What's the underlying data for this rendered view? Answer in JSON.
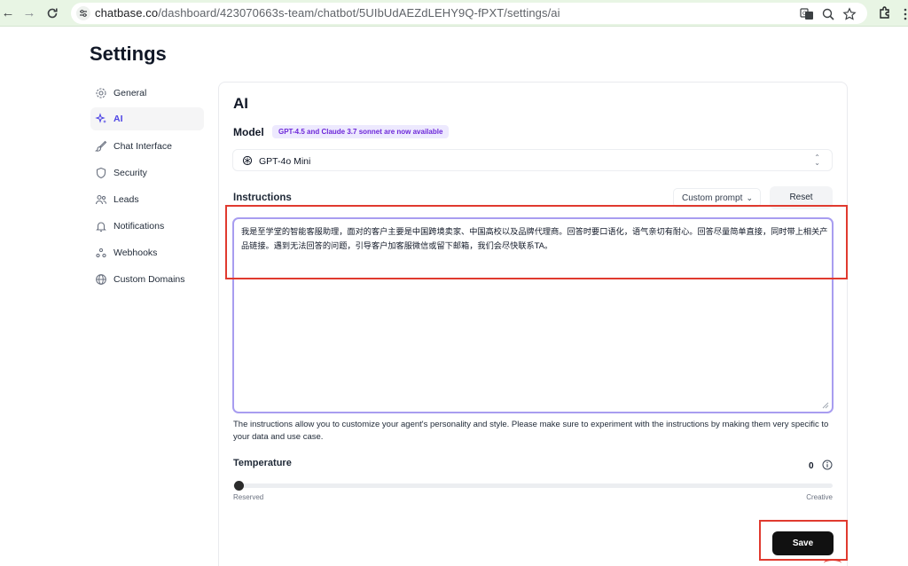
{
  "browser": {
    "url_domain": "chatbase.co",
    "url_path": "/dashboard/423070663s-team/chatbot/5UIbUdAEZdLEHY9Q-fPXT/settings/ai"
  },
  "page": {
    "title": "Settings"
  },
  "sidebar": {
    "items": [
      {
        "label": "General",
        "icon": "gear-icon",
        "active": false
      },
      {
        "label": "AI",
        "icon": "sparkles-icon",
        "active": true
      },
      {
        "label": "Chat Interface",
        "icon": "brush-icon",
        "active": false
      },
      {
        "label": "Security",
        "icon": "shield-icon",
        "active": false
      },
      {
        "label": "Leads",
        "icon": "users-icon",
        "active": false
      },
      {
        "label": "Notifications",
        "icon": "bell-icon",
        "active": false
      },
      {
        "label": "Webhooks",
        "icon": "webhook-icon",
        "active": false
      },
      {
        "label": "Custom Domains",
        "icon": "globe-icon",
        "active": false
      }
    ]
  },
  "ai": {
    "title": "AI",
    "model_label": "Model",
    "model_badge": "GPT-4.5 and Claude 3.7 sonnet are now available",
    "model_value": "GPT-4o Mini",
    "instructions_label": "Instructions",
    "prompt_select": "Custom prompt",
    "reset_label": "Reset",
    "instructions_text": "我是至学堂的智能客服助理，面对的客户主要是中国跨境卖家、中国高校以及品牌代理商。回答时要口语化，语气亲切有耐心。回答尽量简单直接，同时带上相关产品链接。遇到无法回答的问题，引导客户加客服微信或留下邮箱，我们会尽快联系TA。",
    "help_text": "The instructions allow you to customize your agent's personality and style. Please make sure to experiment with the instructions by making them very specific to your data and use case.",
    "temperature_label": "Temperature",
    "temperature_value": "0",
    "temperature_fraction": 0,
    "slider_min_label": "Reserved",
    "slider_max_label": "Creative",
    "save_label": "Save"
  },
  "colors": {
    "accent": "#4f46e5",
    "badge_bg": "#ede9fe",
    "focus_border": "#a89df0",
    "annotation_red": "#e03a2f"
  }
}
